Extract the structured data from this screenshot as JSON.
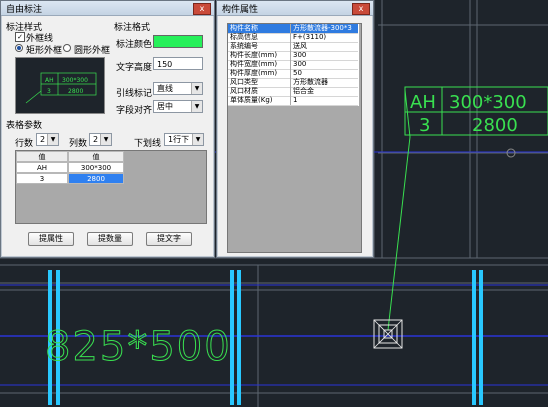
{
  "cad": {
    "table_cells": [
      "AH",
      "300*300",
      "3",
      "2800"
    ],
    "big_label": "825*500",
    "colors": {
      "bg": "#1e242b",
      "green": "#39e050",
      "cyan": "#29c8ff",
      "blue": "#2a35d8"
    }
  },
  "dialog": {
    "title": "自由标注",
    "close": "x",
    "style_group": "标注样式",
    "outer_frame": "外框线",
    "outer_frame_checked": "✓",
    "rect_frame": "矩形外框",
    "circle_frame": "圆形外框",
    "preview": [
      "AH",
      "300*300",
      "3",
      "2800"
    ],
    "format_group": "标注格式",
    "color_label": "标注颜色",
    "color_value": "#27f05a",
    "text_height_label": "文字高度",
    "text_height_value": "150",
    "leader_label": "引线标记",
    "leader_value": "直线",
    "align_label": "字段对齐",
    "align_value": "居中",
    "table_group": "表格参数",
    "rows_label": "行数",
    "rows_value": "2",
    "cols_label": "列数",
    "cols_value": "2",
    "underline_label": "下划线",
    "underline_value": "1行下",
    "grid_header": [
      "值",
      "值"
    ],
    "grid_rows": [
      [
        "AH",
        "300*300"
      ],
      [
        "3",
        "2800"
      ]
    ],
    "btn_attr": "提属性",
    "btn_qty": "提数量",
    "btn_text": "提文字"
  },
  "props": {
    "title": "构件属性",
    "close": "x",
    "rows": [
      {
        "k": "构件名称",
        "v": "方形散流器-300*3"
      },
      {
        "k": "标高信息",
        "v": "F+(3110)"
      },
      {
        "k": "系统编号",
        "v": "送风"
      },
      {
        "k": "构件长度(mm)",
        "v": "300"
      },
      {
        "k": "构件宽度(mm)",
        "v": "300"
      },
      {
        "k": "构件厚度(mm)",
        "v": "50"
      },
      {
        "k": "风口类型",
        "v": "方形散流器"
      },
      {
        "k": "风口材质",
        "v": "铝合金"
      },
      {
        "k": "单体质量(Kg)",
        "v": "1"
      }
    ]
  }
}
